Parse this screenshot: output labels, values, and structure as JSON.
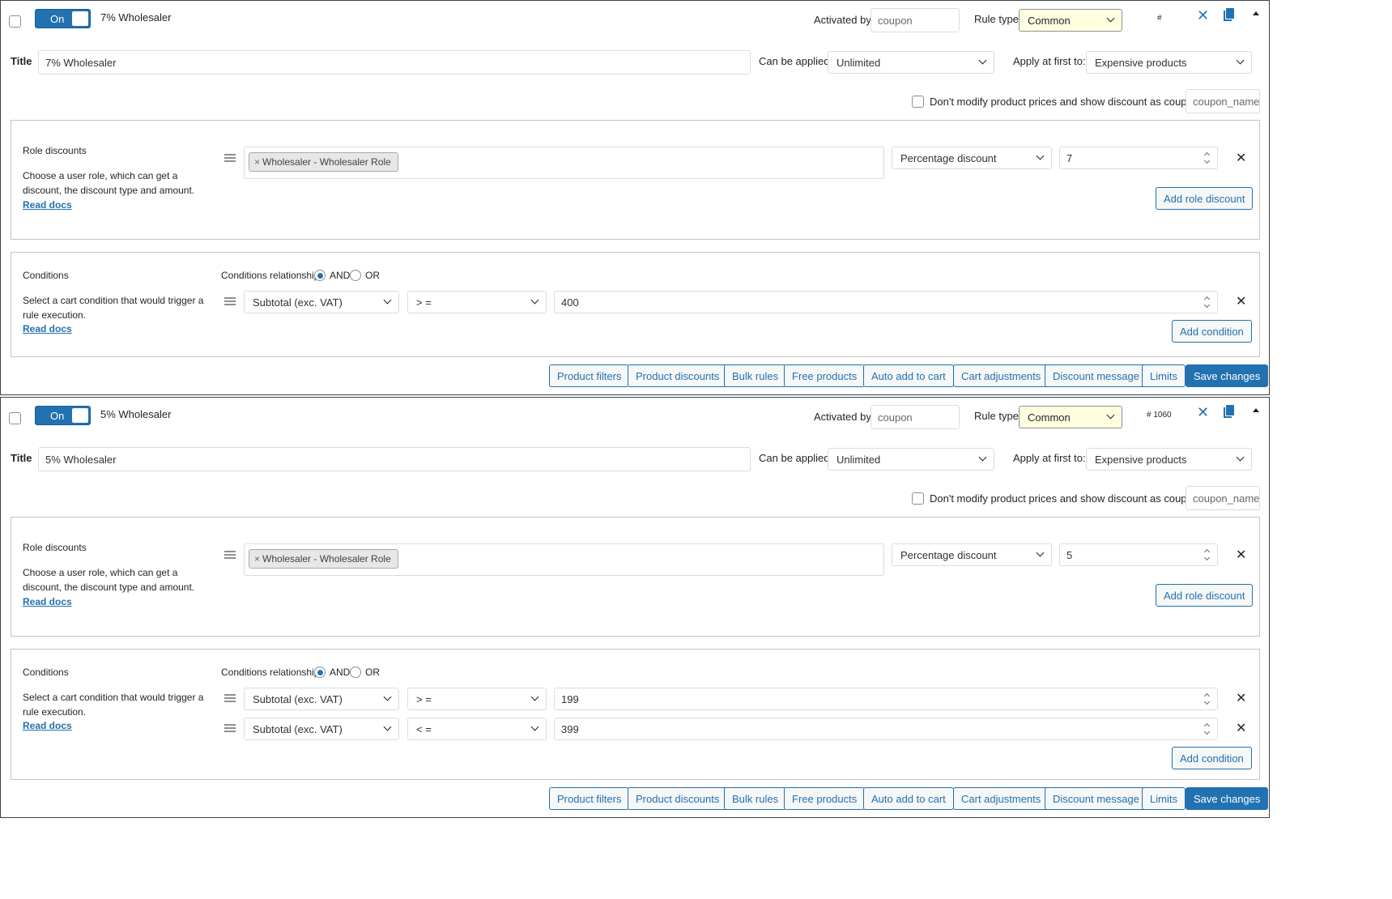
{
  "rules": [
    {
      "enabled_label": "On",
      "name": "7% Wholesaler",
      "activated_by_label": "Activated by",
      "activated_by_placeholder": "coupon",
      "rule_type_label": "Rule type",
      "rule_type_value": "Common",
      "rule_id": "#",
      "title_label": "Title",
      "title_value": "7% Wholesaler",
      "can_be_applied_label": "Can be applied",
      "can_be_applied_value": "Unlimited",
      "apply_first_label": "Apply at first to:",
      "apply_first_value": "Expensive products",
      "dont_modify_label": "Don't modify product prices and show discount as coupon",
      "coupon_name_placeholder": "coupon_name",
      "role_discounts": {
        "title": "Role discounts",
        "description": "Choose a user role, which can get a discount, the discount type and amount.",
        "read_docs": "Read docs",
        "role_tag": "Wholesaler - Wholesaler Role",
        "discount_type": "Percentage discount",
        "amount": "7",
        "add_button": "Add role discount"
      },
      "conditions": {
        "title": "Conditions",
        "description": "Select a cart condition that would trigger a rule execution.",
        "read_docs": "Read docs",
        "relationship_label": "Conditions relationship",
        "and_label": "AND",
        "or_label": "OR",
        "rows": [
          {
            "field": "Subtotal (exc. VAT)",
            "operator": "> =",
            "value": "400"
          }
        ],
        "add_button": "Add condition"
      }
    },
    {
      "enabled_label": "On",
      "name": "5% Wholesaler",
      "activated_by_label": "Activated by",
      "activated_by_placeholder": "coupon",
      "rule_type_label": "Rule type",
      "rule_type_value": "Common",
      "rule_id": "# 1060",
      "title_label": "Title",
      "title_value": "5% Wholesaler",
      "can_be_applied_label": "Can be applied",
      "can_be_applied_value": "Unlimited",
      "apply_first_label": "Apply at first to:",
      "apply_first_value": "Expensive products",
      "dont_modify_label": "Don't modify product prices and show discount as coupon",
      "coupon_name_placeholder": "coupon_name",
      "role_discounts": {
        "title": "Role discounts",
        "description": "Choose a user role, which can get a discount, the discount type and amount.",
        "read_docs": "Read docs",
        "role_tag": "Wholesaler - Wholesaler Role",
        "discount_type": "Percentage discount",
        "amount": "5",
        "add_button": "Add role discount"
      },
      "conditions": {
        "title": "Conditions",
        "description": "Select a cart condition that would trigger a rule execution.",
        "read_docs": "Read docs",
        "relationship_label": "Conditions relationship",
        "and_label": "AND",
        "or_label": "OR",
        "rows": [
          {
            "field": "Subtotal (exc. VAT)",
            "operator": "> =",
            "value": "199"
          },
          {
            "field": "Subtotal (exc. VAT)",
            "operator": "< =",
            "value": "399"
          }
        ],
        "add_button": "Add condition"
      }
    }
  ],
  "footer_buttons": {
    "product_filters": "Product filters",
    "product_discounts": "Product discounts",
    "bulk_rules": "Bulk rules",
    "free_products": "Free products",
    "auto_add": "Auto add to cart",
    "cart_adjustments": "Cart adjustments",
    "discount_message": "Discount message",
    "limits": "Limits",
    "save": "Save changes"
  },
  "colors": {
    "accent": "#2271b1",
    "rule_type_bg": "#ffffe0"
  },
  "icons": [
    "close-icon",
    "copy-icon",
    "collapse-caret-icon",
    "drag-handle-icon",
    "remove-icon",
    "chevron-down-icon"
  ]
}
